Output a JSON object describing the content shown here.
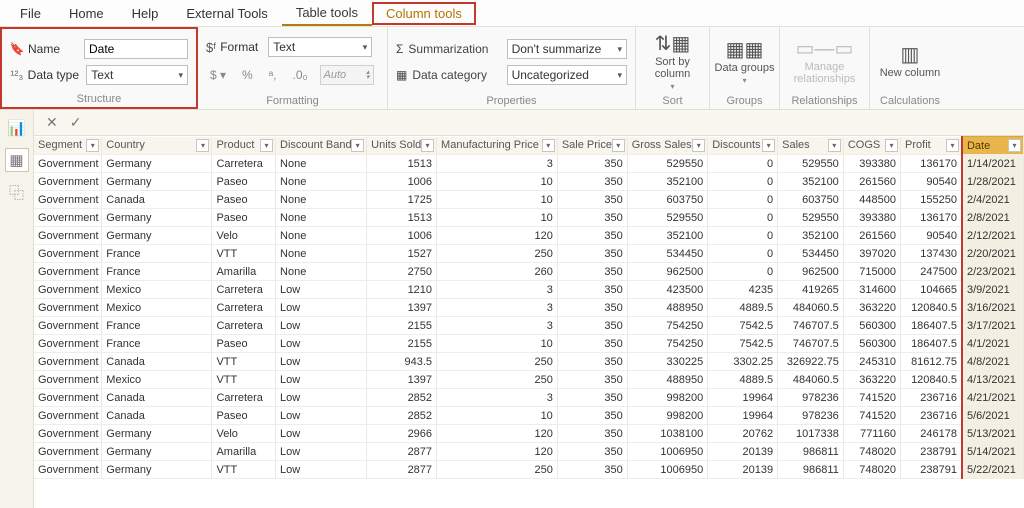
{
  "menu": {
    "file": "File",
    "home": "Home",
    "help": "Help",
    "external": "External Tools",
    "table_tools": "Table tools",
    "column_tools": "Column tools"
  },
  "ribbon": {
    "structure": {
      "title": "Structure",
      "name_label": "Name",
      "name_value": "Date",
      "type_label": "Data type",
      "type_value": "Text"
    },
    "formatting": {
      "title": "Formatting",
      "format_label": "Format",
      "format_value": "Text",
      "currency": "$",
      "percent": "%",
      "comma": ",",
      "decimal": ".00",
      "auto": "Auto"
    },
    "properties": {
      "title": "Properties",
      "sum_label": "Summarization",
      "sum_value": "Don't summarize",
      "cat_label": "Data category",
      "cat_value": "Uncategorized"
    },
    "sort": {
      "title": "Sort",
      "btn": "Sort by column",
      "arrow": "▾"
    },
    "groups": {
      "title": "Groups",
      "btn": "Data groups",
      "arrow": "▾"
    },
    "rel": {
      "title": "Relationships",
      "btn": "Manage relationships"
    },
    "calc": {
      "title": "Calculations",
      "btn": "New column"
    }
  },
  "columns": [
    "Segment",
    "Country",
    "Product",
    "Discount Band",
    "Units Sold",
    "Manufacturing Price",
    "Sale Price",
    "Gross Sales",
    "Discounts",
    "Sales",
    "COGS",
    "Profit",
    "Date"
  ],
  "rows": [
    [
      "Government",
      "Germany",
      "Carretera",
      "None",
      "1513",
      "3",
      "350",
      "529550",
      "0",
      "529550",
      "393380",
      "136170",
      "1/14/2021"
    ],
    [
      "Government",
      "Germany",
      "Paseo",
      "None",
      "1006",
      "10",
      "350",
      "352100",
      "0",
      "352100",
      "261560",
      "90540",
      "1/28/2021"
    ],
    [
      "Government",
      "Canada",
      "Paseo",
      "None",
      "1725",
      "10",
      "350",
      "603750",
      "0",
      "603750",
      "448500",
      "155250",
      "2/4/2021"
    ],
    [
      "Government",
      "Germany",
      "Paseo",
      "None",
      "1513",
      "10",
      "350",
      "529550",
      "0",
      "529550",
      "393380",
      "136170",
      "2/8/2021"
    ],
    [
      "Government",
      "Germany",
      "Velo",
      "None",
      "1006",
      "120",
      "350",
      "352100",
      "0",
      "352100",
      "261560",
      "90540",
      "2/12/2021"
    ],
    [
      "Government",
      "France",
      "VTT",
      "None",
      "1527",
      "250",
      "350",
      "534450",
      "0",
      "534450",
      "397020",
      "137430",
      "2/20/2021"
    ],
    [
      "Government",
      "France",
      "Amarilla",
      "None",
      "2750",
      "260",
      "350",
      "962500",
      "0",
      "962500",
      "715000",
      "247500",
      "2/23/2021"
    ],
    [
      "Government",
      "Mexico",
      "Carretera",
      "Low",
      "1210",
      "3",
      "350",
      "423500",
      "4235",
      "419265",
      "314600",
      "104665",
      "3/9/2021"
    ],
    [
      "Government",
      "Mexico",
      "Carretera",
      "Low",
      "1397",
      "3",
      "350",
      "488950",
      "4889.5",
      "484060.5",
      "363220",
      "120840.5",
      "3/16/2021"
    ],
    [
      "Government",
      "France",
      "Carretera",
      "Low",
      "2155",
      "3",
      "350",
      "754250",
      "7542.5",
      "746707.5",
      "560300",
      "186407.5",
      "3/17/2021"
    ],
    [
      "Government",
      "France",
      "Paseo",
      "Low",
      "2155",
      "10",
      "350",
      "754250",
      "7542.5",
      "746707.5",
      "560300",
      "186407.5",
      "4/1/2021"
    ],
    [
      "Government",
      "Canada",
      "VTT",
      "Low",
      "943.5",
      "250",
      "350",
      "330225",
      "3302.25",
      "326922.75",
      "245310",
      "81612.75",
      "4/8/2021"
    ],
    [
      "Government",
      "Mexico",
      "VTT",
      "Low",
      "1397",
      "250",
      "350",
      "488950",
      "4889.5",
      "484060.5",
      "363220",
      "120840.5",
      "4/13/2021"
    ],
    [
      "Government",
      "Canada",
      "Carretera",
      "Low",
      "2852",
      "3",
      "350",
      "998200",
      "19964",
      "978236",
      "741520",
      "236716",
      "4/21/2021"
    ],
    [
      "Government",
      "Canada",
      "Paseo",
      "Low",
      "2852",
      "10",
      "350",
      "998200",
      "19964",
      "978236",
      "741520",
      "236716",
      "5/6/2021"
    ],
    [
      "Government",
      "Germany",
      "Velo",
      "Low",
      "2966",
      "120",
      "350",
      "1038100",
      "20762",
      "1017338",
      "771160",
      "246178",
      "5/13/2021"
    ],
    [
      "Government",
      "Germany",
      "Amarilla",
      "Low",
      "2877",
      "120",
      "350",
      "1006950",
      "20139",
      "986811",
      "748020",
      "238791",
      "5/14/2021"
    ],
    [
      "Government",
      "Germany",
      "VTT",
      "Low",
      "2877",
      "250",
      "350",
      "1006950",
      "20139",
      "986811",
      "748020",
      "238791",
      "5/22/2021"
    ]
  ]
}
